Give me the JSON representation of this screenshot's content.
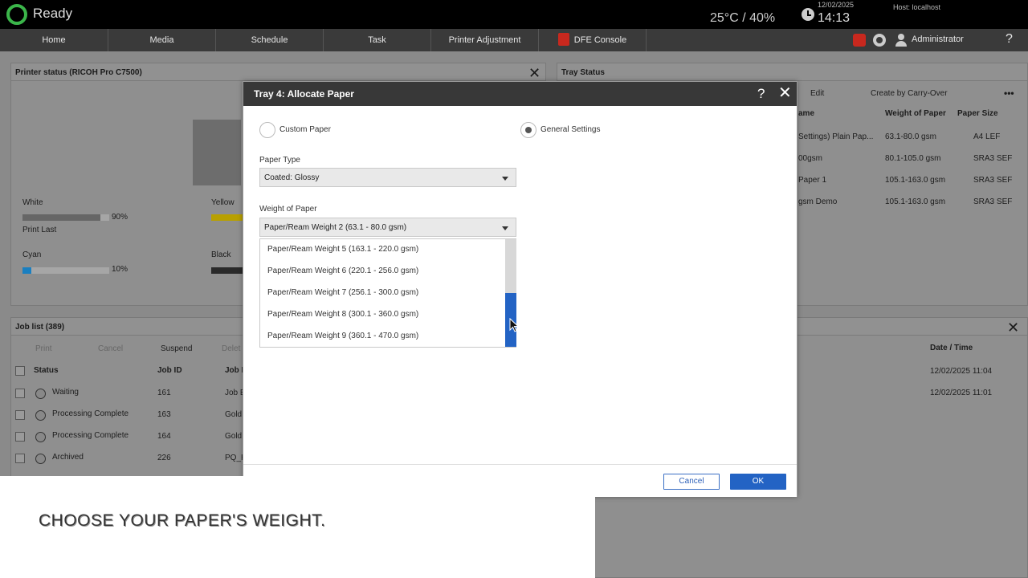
{
  "topbar": {
    "status": "Ready",
    "environment": "25°C / 40%",
    "date": "12/02/2025",
    "time": "14:13",
    "host": "Host: localhost"
  },
  "nav": {
    "items": [
      "Home",
      "Media",
      "Schedule",
      "Task",
      "Printer Adjustment",
      "DFE Console"
    ],
    "user": "Administrator",
    "help": "?"
  },
  "printer_status": {
    "title": "Printer status (RICOH Pro C7500)",
    "toners": [
      {
        "name": "White",
        "level_percent": 90,
        "label": "90%",
        "color": "#666666"
      },
      {
        "name": "Yellow",
        "level_percent": 100,
        "label": "",
        "color": "#b8a000"
      },
      {
        "name": "Cyan",
        "level_percent": 10,
        "label": "10%",
        "color": "#1a7fc0"
      },
      {
        "name": "Black",
        "level_percent": 100,
        "label": "",
        "color": "#2a2a2a"
      }
    ],
    "print_last": "Print Last"
  },
  "tray_status": {
    "title": "Tray Status",
    "toolbar": {
      "edit": "Edit",
      "create": "Create by Carry-Over",
      "more": "•••"
    },
    "columns": [
      "ame",
      "Weight of Paper",
      "Paper Size"
    ],
    "rows": [
      {
        "name": "Settings) Plain Pap...",
        "weight": "63.1-80.0 gsm",
        "size": "A4 LEF"
      },
      {
        "name": "00gsm",
        "weight": "80.1-105.0 gsm",
        "size": "SRA3 SEF"
      },
      {
        "name": "Paper 1",
        "weight": "105.1-163.0 gsm",
        "size": "SRA3 SEF"
      },
      {
        "name": "gsm Demo",
        "weight": "105.1-163.0 gsm",
        "size": "SRA3 SEF"
      }
    ]
  },
  "job_list": {
    "title": "Job list (389)",
    "toolbar": {
      "print": "Print",
      "cancel": "Cancel",
      "suspend": "Suspend",
      "delete": "Delet"
    },
    "columns": {
      "status": "Status",
      "job_id": "Job ID",
      "job_name": "Job N",
      "date": "Date / Time"
    },
    "rows": [
      {
        "status": "Waiting",
        "id": "161",
        "name": "Job E",
        "date": "12/02/2025 11:04"
      },
      {
        "status": "Processing Complete",
        "id": "163",
        "name": "Gold.",
        "date": "12/02/2025 11:01"
      },
      {
        "status": "Processing Complete",
        "id": "164",
        "name": "Gold.",
        "date": ""
      },
      {
        "status": "Archived",
        "id": "226",
        "name": "PQ_H",
        "date": ""
      }
    ]
  },
  "dialog": {
    "title": "Tray 4: Allocate Paper",
    "help": "?",
    "radio_custom": "Custom Paper",
    "radio_general": "General Settings",
    "paper_type_label": "Paper Type",
    "paper_type_value": "Coated: Glossy",
    "weight_label": "Weight of Paper",
    "weight_value": "Paper/Ream Weight 2 (63.1 - 80.0 gsm)",
    "weight_options": [
      "Paper/Ream Weight 5 (163.1 - 220.0 gsm)",
      "Paper/Ream Weight 6 (220.1 - 256.0 gsm)",
      "Paper/Ream Weight 7 (256.1 - 300.0 gsm)",
      "Paper/Ream Weight 8 (300.1 - 360.0 gsm)",
      "Paper/Ream Weight 9 (360.1 - 470.0 gsm)"
    ],
    "cancel": "Cancel",
    "ok": "OK"
  },
  "caption": "CHOOSE YOUR PAPER'S WEIGHT."
}
